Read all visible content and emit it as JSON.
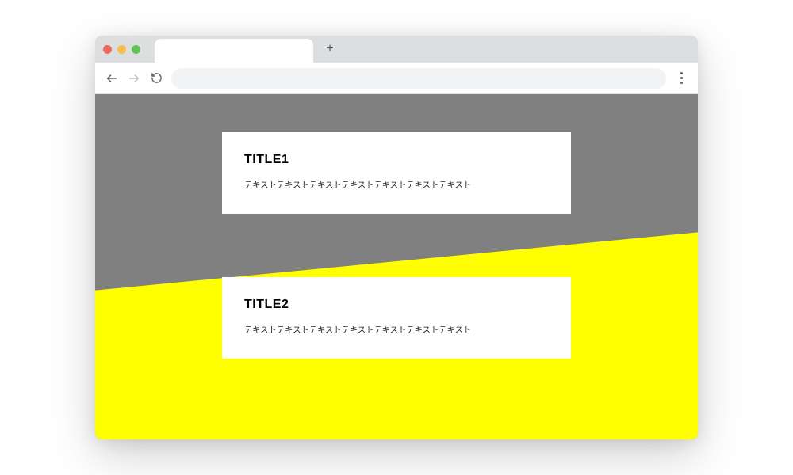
{
  "browser": {
    "tab_title": "",
    "address": "",
    "newtab_glyph": "+"
  },
  "page": {
    "bg_colors": {
      "top": "#808080",
      "bottom": "#ffff00"
    },
    "cards": [
      {
        "title": "TITLE1",
        "text": "テキストテキストテキストテキストテキストテキストテキスト"
      },
      {
        "title": "TITLE2",
        "text": "テキストテキストテキストテキストテキストテキストテキスト"
      }
    ]
  }
}
